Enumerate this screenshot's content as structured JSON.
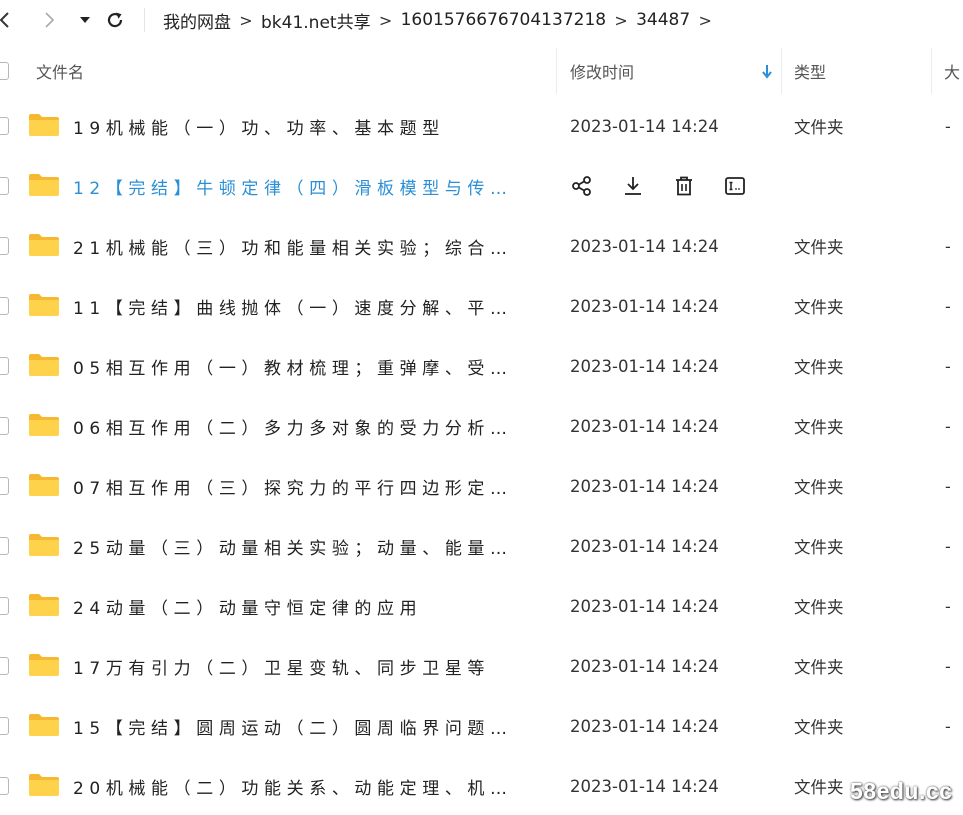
{
  "breadcrumb": [
    "我的网盘",
    "bk41.net共享",
    "1601576676704137218",
    "34487"
  ],
  "breadcrumb_separator": ">",
  "columns": {
    "name": "文件名",
    "modified": "修改时间",
    "type": "类型",
    "size": "大"
  },
  "files": [
    {
      "name": "19机械能（一）功、功率、基本题型",
      "modified": "2023-01-14 14:24",
      "type": "文件夹",
      "size": "-"
    },
    {
      "name": "12【完结】牛顿定律（四）滑板模型与传…",
      "modified": "",
      "type": "",
      "size": "",
      "hovered": true
    },
    {
      "name": "21机械能（三）功和能量相关实验；综合…",
      "modified": "2023-01-14 14:24",
      "type": "文件夹",
      "size": "-"
    },
    {
      "name": "11【完结】曲线抛体（一）速度分解、平…",
      "modified": "2023-01-14 14:24",
      "type": "文件夹",
      "size": "-"
    },
    {
      "name": "05相互作用（一）教材梳理；重弹摩、受…",
      "modified": "2023-01-14 14:24",
      "type": "文件夹",
      "size": "-"
    },
    {
      "name": "06相互作用（二）多力多对象的受力分析…",
      "modified": "2023-01-14 14:24",
      "type": "文件夹",
      "size": "-"
    },
    {
      "name": "07相互作用（三）探究力的平行四边形定…",
      "modified": "2023-01-14 14:24",
      "type": "文件夹",
      "size": "-"
    },
    {
      "name": "25动量（三）动量相关实验；动量、能量…",
      "modified": "2023-01-14 14:24",
      "type": "文件夹",
      "size": "-"
    },
    {
      "name": "24动量（二）动量守恒定律的应用",
      "modified": "2023-01-14 14:24",
      "type": "文件夹",
      "size": "-"
    },
    {
      "name": "17万有引力（二）卫星变轨、同步卫星等",
      "modified": "2023-01-14 14:24",
      "type": "文件夹",
      "size": "-"
    },
    {
      "name": "15【完结】圆周运动（二）圆周临界问题…",
      "modified": "2023-01-14 14:24",
      "type": "文件夹",
      "size": "-"
    },
    {
      "name": "20机械能（二）功能关系、动能定理、机…",
      "modified": "2023-01-14 14:24",
      "type": "文件夹",
      "size": "-"
    }
  ],
  "row_actions": [
    "share-icon",
    "download-icon",
    "delete-icon",
    "rename-icon"
  ],
  "watermark": "58edu.cc",
  "colors": {
    "accent": "#2a8fd6",
    "folder": "#f7c948",
    "text": "#222222"
  }
}
